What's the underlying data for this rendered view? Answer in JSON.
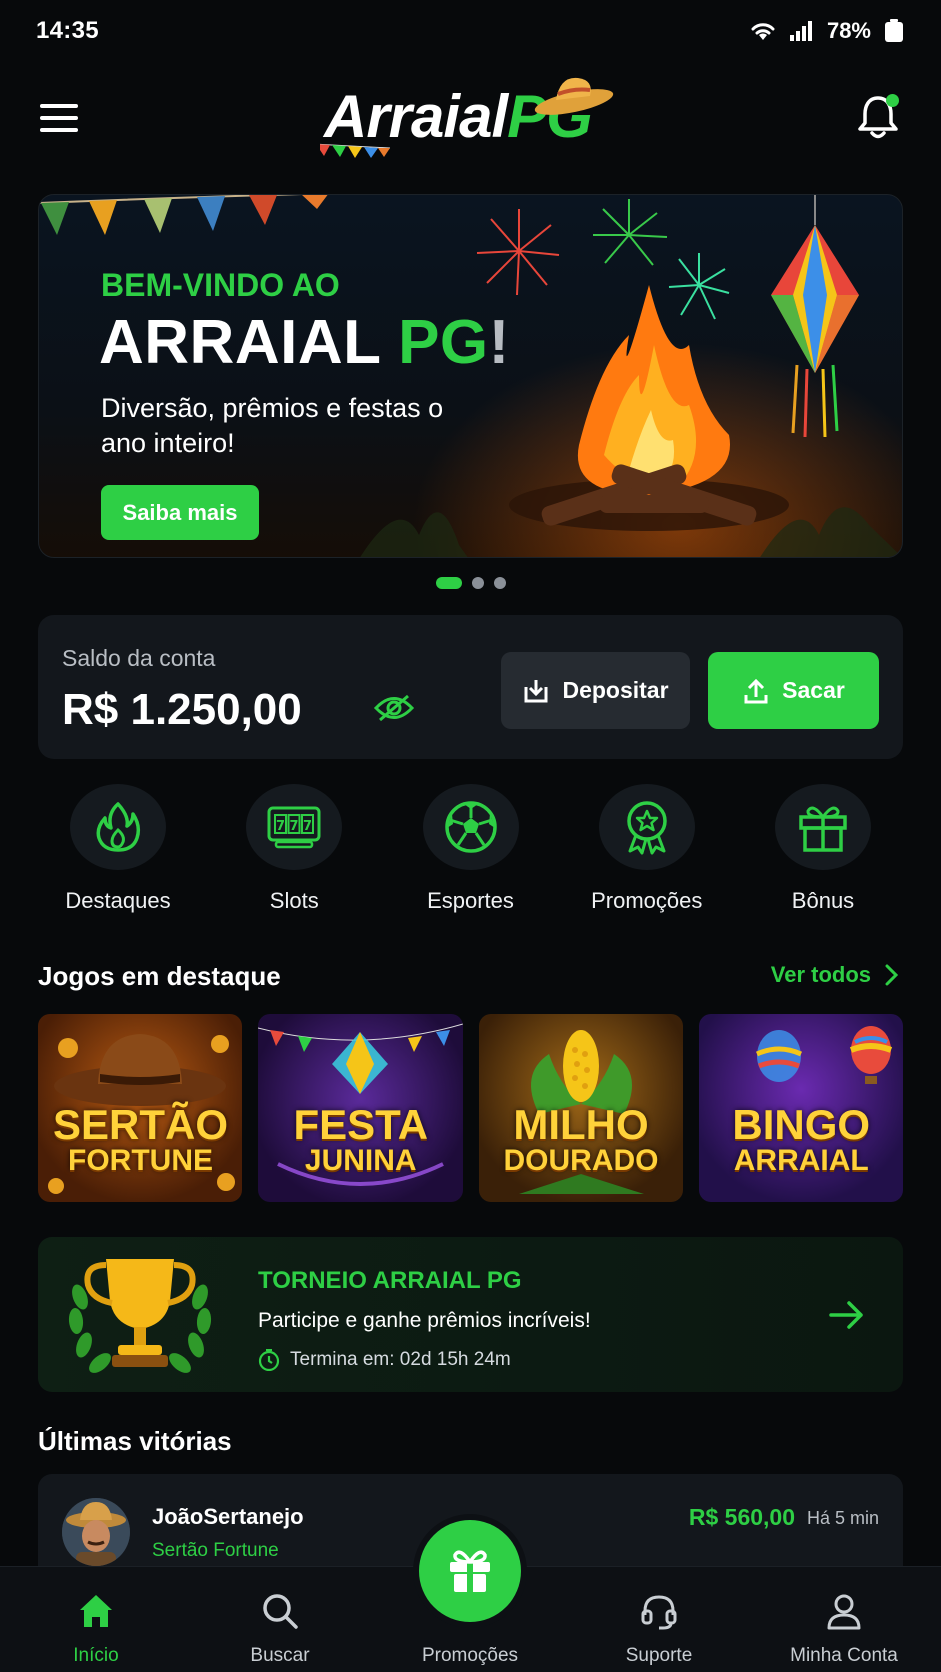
{
  "status_bar": {
    "time": "14:35",
    "battery": "78%"
  },
  "header": {
    "logo_part1": "Arraial",
    "logo_part2": "PG"
  },
  "banner": {
    "eyebrow": "BEM-VINDO AO",
    "headline_part1": "ARRAIAL ",
    "headline_part2": "PG",
    "headline_part3": "!",
    "subtitle": "Diversão, prêmios e festas o ano inteiro!",
    "cta_label": "Saiba mais",
    "slides_total": 3,
    "active_slide": 1
  },
  "balance": {
    "label": "Saldo da conta",
    "amount": "R$ 1.250,00",
    "deposit_label": "Depositar",
    "withdraw_label": "Sacar"
  },
  "categories": [
    {
      "label": "Destaques",
      "icon": "flame-icon"
    },
    {
      "label": "Slots",
      "icon": "slot-machine-icon"
    },
    {
      "label": "Esportes",
      "icon": "soccer-ball-icon"
    },
    {
      "label": "Promoções",
      "icon": "medal-icon"
    },
    {
      "label": "Bônus",
      "icon": "gift-icon"
    }
  ],
  "featured": {
    "title": "Jogos em destaque",
    "see_all": "Ver todos",
    "games": [
      {
        "line1": "SERTÃO",
        "line2": "FORTUNE"
      },
      {
        "line1": "FESTA",
        "line2": "JUNINA"
      },
      {
        "line1": "MILHO",
        "line2": "DOURADO"
      },
      {
        "line1": "BINGO",
        "line2": "ARRAIAL"
      }
    ]
  },
  "tournament": {
    "title": "TORNEIO ARRAIAL PG",
    "subtitle": "Participe e ganhe prêmios incríveis!",
    "ends": "Termina em: 02d 15h 24m"
  },
  "last_wins": {
    "title": "Últimas vitórias",
    "items": [
      {
        "user": "JoãoSertanejo",
        "game": "Sertão Fortune",
        "amount": "R$ 560,00",
        "time": "Há 5 min"
      }
    ]
  },
  "bottom_nav": {
    "items": [
      {
        "label": "Início",
        "active": true
      },
      {
        "label": "Buscar",
        "active": false
      },
      {
        "label": "Promoções",
        "active": false
      },
      {
        "label": "Suporte",
        "active": false
      },
      {
        "label": "Minha Conta",
        "active": false
      }
    ]
  },
  "colors": {
    "accent": "#2ecf45",
    "background": "#07090b",
    "card": "#13171c"
  }
}
